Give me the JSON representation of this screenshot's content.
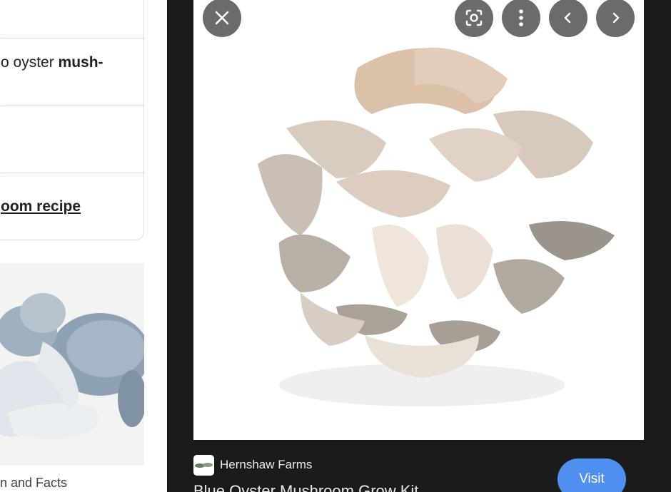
{
  "left_pane": {
    "suggestions": [
      {
        "prefix": "o oyster ",
        "bold": "mush-"
      },
      {
        "prefix": "",
        "bold": ""
      },
      {
        "link": "oom recipe"
      }
    ],
    "thumbnail_caption": "n and Facts"
  },
  "viewer": {
    "toolbar": {
      "close_icon": "close-icon",
      "lens_icon": "lens-search-icon",
      "more_icon": "more-vert-icon",
      "prev_icon": "chevron-left-icon",
      "next_icon": "chevron-right-icon"
    },
    "source_name": "Hernshaw Farms",
    "result_title": "Blue Oyster Mushroom Grow Kit",
    "visit_label": "Visit",
    "colors": {
      "background": "#1b1b1b",
      "button": "#6b6b6b",
      "visit": "#4f8ff0"
    }
  }
}
